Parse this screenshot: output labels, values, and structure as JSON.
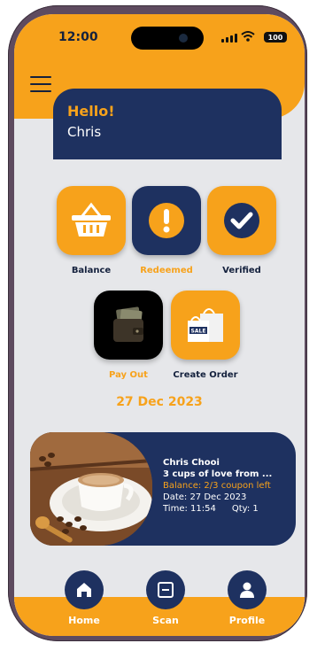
{
  "status": {
    "time": "12:00",
    "battery": "100"
  },
  "header": {
    "greeting": "Hello!",
    "user_name": "Chris"
  },
  "tiles": [
    {
      "label": "Balance",
      "icon": "basket-icon",
      "label_color": "navy"
    },
    {
      "label": "Redeemed",
      "icon": "exclamation-icon",
      "label_color": "orange"
    },
    {
      "label": "Verified",
      "icon": "check-icon",
      "label_color": "navy"
    },
    {
      "label": "Pay Out",
      "icon": "wallet-icon",
      "label_color": "orange"
    },
    {
      "label": "Create Order",
      "icon": "shopping-bags-icon",
      "label_color": "navy"
    }
  ],
  "date": "27 Dec 2023",
  "order": {
    "customer": "Chris Chooi",
    "item": "3 cups of love from ...",
    "balance": "Balance: 2/3 coupon left",
    "date": "Date:  27 Dec 2023",
    "time": "Time:  11:54",
    "qty": "Qty: 1",
    "image": "coffee-cup-photo"
  },
  "nav": [
    {
      "label": "Home",
      "icon": "home-icon"
    },
    {
      "label": "Scan",
      "icon": "scan-icon"
    },
    {
      "label": "Profile",
      "icon": "profile-icon"
    }
  ],
  "colors": {
    "accent": "#f7a21b",
    "navy": "#1e3160",
    "background": "#e6e7ea"
  }
}
